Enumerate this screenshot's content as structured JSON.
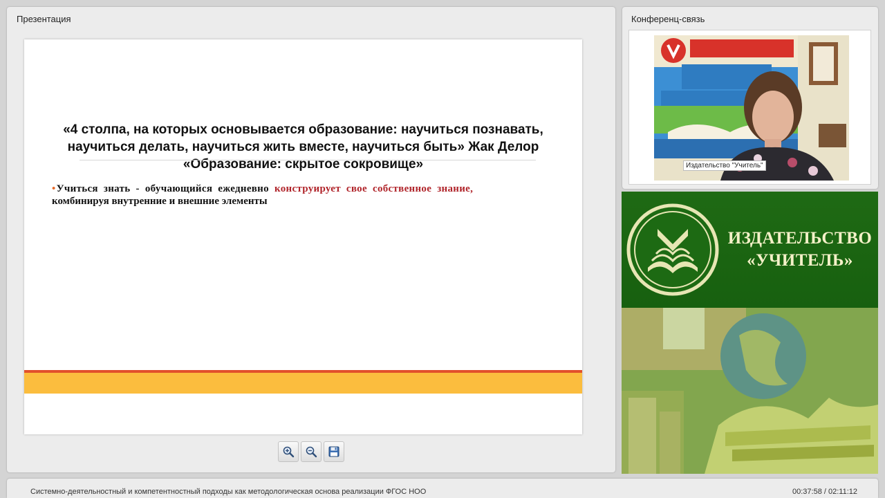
{
  "presentation": {
    "panel_title": "Презентация",
    "slide": {
      "title_lines": [
        "«4 столпа, на которых основывается образование: научиться познавать,",
        "научиться  делать, научиться жить вместе, научиться быть» Жак Делор",
        "«Образование: скрытое сокровище»"
      ],
      "bullet": {
        "mark": "•",
        "text_before": "Учиться знать - обучающийся ежедневно ",
        "text_accent": "конструирует свое собственное знание,",
        "text_after": "комбинируя внутренние и внешние элементы"
      },
      "accent_colors": {
        "bullet_mark": "#e86a2a",
        "highlight_text": "#b0242a",
        "band_red": "#e2502b",
        "band_yellow": "#fbbd3e"
      }
    },
    "toolbar": {
      "zoom_in_icon": "zoom-in-icon",
      "zoom_out_icon": "zoom-out-icon",
      "save_icon": "floppy-disk-icon"
    }
  },
  "conference": {
    "panel_title": "Конференц-связь",
    "video": {
      "caption": "Издательство \"Учитель\""
    }
  },
  "banner": {
    "line1": "ИЗДАТЕЛЬСТВО",
    "line2": "«УЧИТЕЛЬ»"
  },
  "footer": {
    "title": "Системно-деятельностный и компетентностный подходы как методологическая основа реализации ФГОС НОО",
    "time": "00:37:58 / 02:11:12"
  }
}
